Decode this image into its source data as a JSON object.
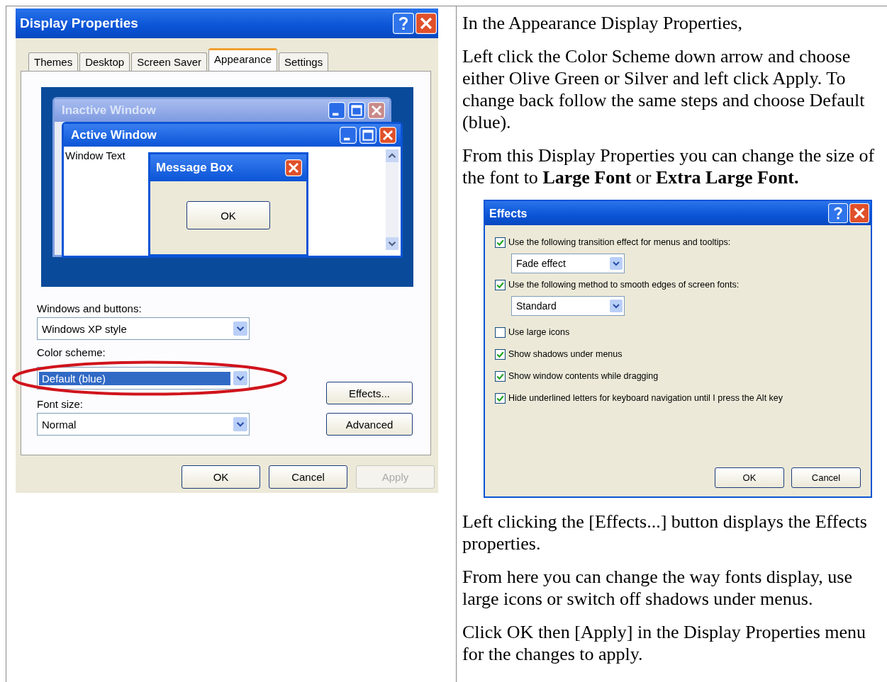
{
  "display_properties": {
    "title": "Display Properties",
    "tabs": [
      {
        "label": "Themes",
        "selected": false
      },
      {
        "label": "Desktop",
        "selected": false
      },
      {
        "label": "Screen Saver",
        "selected": false
      },
      {
        "label": "Appearance",
        "selected": true
      },
      {
        "label": "Settings",
        "selected": false
      }
    ],
    "preview": {
      "inactive_title": "Inactive Window",
      "active_title": "Active Window",
      "window_text": "Window Text",
      "message_title": "Message Box",
      "message_button": "OK"
    },
    "fields": [
      {
        "label": "Windows and buttons:",
        "value": "Windows XP style",
        "highlighted": false
      },
      {
        "label": "Color scheme:",
        "value": "Default (blue)",
        "highlighted": true
      },
      {
        "label": "Font size:",
        "value": "Normal",
        "highlighted": false
      }
    ],
    "side_buttons": [
      "Effects...",
      "Advanced"
    ],
    "buttons": [
      {
        "label": "OK",
        "disabled": false
      },
      {
        "label": "Cancel",
        "disabled": false
      },
      {
        "label": "Apply",
        "disabled": true
      }
    ]
  },
  "instructions_top": [
    "In the Appearance Display Properties,",
    "Left click the Color Scheme down arrow and choose either Olive Green or Silver and left click Apply. To change back follow the same steps and choose Default (blue).",
    "From this Display Properties you can change the size of the font to **Large Font** or **Extra Large Font.**"
  ],
  "effects": {
    "title": "Effects",
    "options": [
      {
        "kind": "checkbox",
        "label": "Use the following transition effect for menus and tooltips:",
        "checked": true
      },
      {
        "kind": "dropdown",
        "value": "Fade effect"
      },
      {
        "kind": "checkbox",
        "label": "Use the following method to smooth edges of screen fonts:",
        "checked": true
      },
      {
        "kind": "dropdown",
        "value": "Standard"
      },
      {
        "kind": "checkbox",
        "label": "Use large icons",
        "checked": false
      },
      {
        "kind": "checkbox",
        "label": "Show shadows under menus",
        "checked": true
      },
      {
        "kind": "checkbox",
        "label": "Show window contents while dragging",
        "checked": true
      },
      {
        "kind": "checkbox",
        "label": "Hide underlined letters for keyboard navigation until I press the Alt key",
        "checked": true
      }
    ],
    "buttons": [
      "OK",
      "Cancel"
    ]
  },
  "instructions_bottom": [
    "Left clicking the [Effects...] button displays the Effects properties.",
    "From here you can change the way fonts display, use large icons or switch off shadows under menus.",
    "Click OK then [Apply] in the Display Properties menu for the changes to apply."
  ]
}
